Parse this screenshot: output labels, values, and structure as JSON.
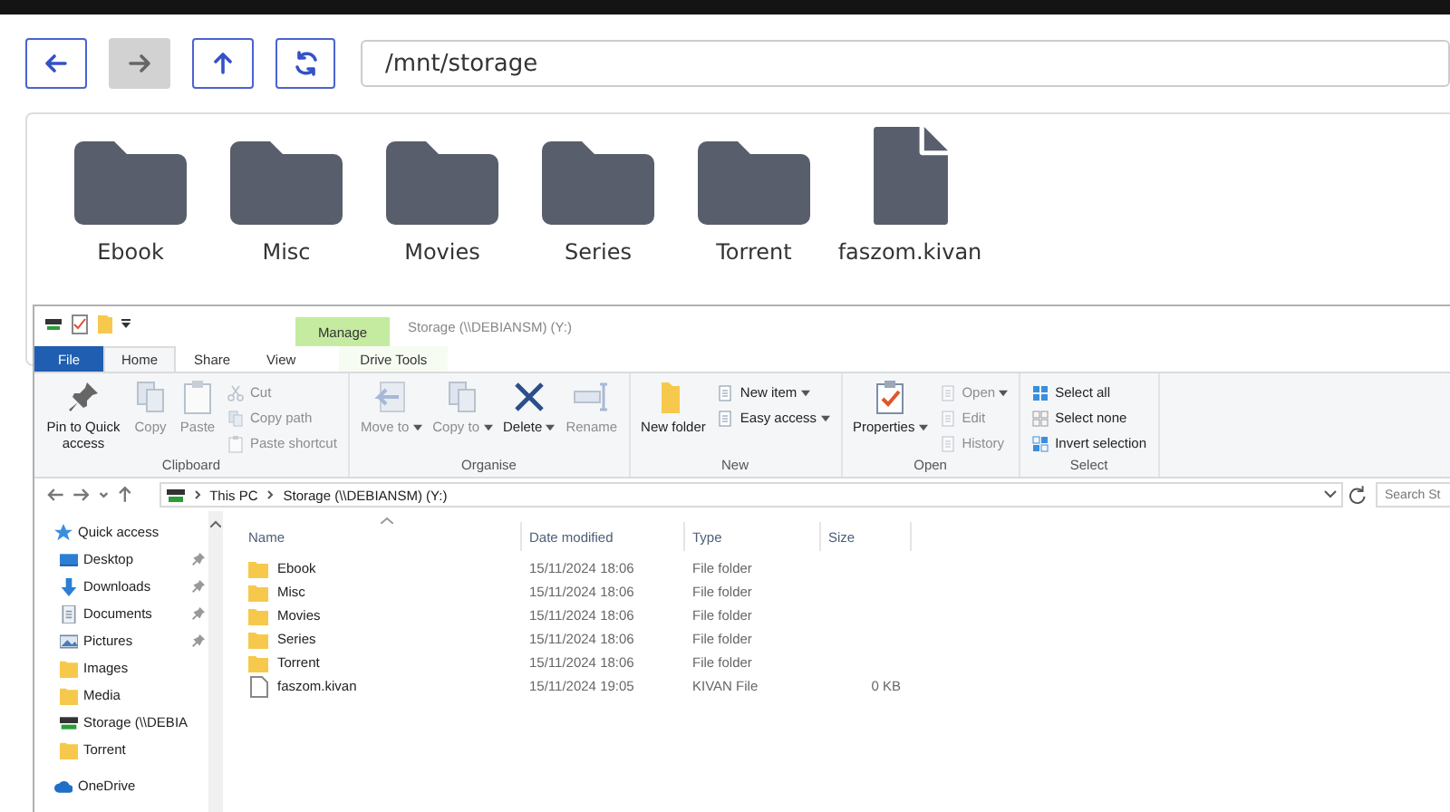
{
  "browser": {
    "nav_buttons": [
      {
        "kind": "back",
        "disabled": false
      },
      {
        "kind": "forward",
        "disabled": true
      },
      {
        "kind": "up",
        "disabled": false
      },
      {
        "kind": "refresh",
        "disabled": false
      }
    ],
    "path": "/mnt/storage",
    "items": [
      {
        "name": "Ebook",
        "kind": "folder"
      },
      {
        "name": "Misc",
        "kind": "folder"
      },
      {
        "name": "Movies",
        "kind": "folder"
      },
      {
        "name": "Series",
        "kind": "folder"
      },
      {
        "name": "Torrent",
        "kind": "folder"
      },
      {
        "name": "faszom.kivan",
        "kind": "file"
      }
    ]
  },
  "explorer": {
    "context_tab": "Manage",
    "title": "Storage (\\\\DEBIANSM) (Y:)",
    "tabs": [
      {
        "label": "File",
        "kind": "file",
        "selected": false
      },
      {
        "label": "Home",
        "kind": "tab",
        "selected": true
      },
      {
        "label": "Share",
        "kind": "tab",
        "selected": false
      },
      {
        "label": "View",
        "kind": "tab",
        "selected": false
      },
      {
        "label": "Drive Tools",
        "kind": "context",
        "selected": false
      }
    ],
    "ribbon": [
      {
        "label": "Clipboard",
        "buttons": [
          {
            "label": "Pin to Quick access",
            "kind": "large",
            "disabled": false,
            "dropdown": false
          },
          {
            "label": "Copy",
            "kind": "large",
            "disabled": true,
            "dropdown": false
          },
          {
            "label": "Paste",
            "kind": "large",
            "disabled": true,
            "dropdown": false
          },
          {
            "label": "Cut",
            "kind": "small",
            "disabled": true,
            "dropdown": false
          },
          {
            "label": "Copy path",
            "kind": "small",
            "disabled": true,
            "dropdown": false
          },
          {
            "label": "Paste shortcut",
            "kind": "small",
            "disabled": true,
            "dropdown": false
          }
        ]
      },
      {
        "label": "Organise",
        "buttons": [
          {
            "label": "Move to",
            "kind": "large",
            "disabled": true,
            "dropdown": true
          },
          {
            "label": "Copy to",
            "kind": "large",
            "disabled": true,
            "dropdown": true
          },
          {
            "label": "Delete",
            "kind": "large",
            "disabled": false,
            "dropdown": true
          },
          {
            "label": "Rename",
            "kind": "large",
            "disabled": true,
            "dropdown": false
          }
        ]
      },
      {
        "label": "New",
        "buttons": [
          {
            "label": "New folder",
            "kind": "large",
            "disabled": false,
            "dropdown": false
          },
          {
            "label": "New item",
            "kind": "small",
            "disabled": false,
            "dropdown": true
          },
          {
            "label": "Easy access",
            "kind": "small",
            "disabled": false,
            "dropdown": true
          }
        ]
      },
      {
        "label": "Open",
        "buttons": [
          {
            "label": "Properties",
            "kind": "large",
            "disabled": false,
            "dropdown": true
          },
          {
            "label": "Open",
            "kind": "small",
            "disabled": true,
            "dropdown": true
          },
          {
            "label": "Edit",
            "kind": "small",
            "disabled": true,
            "dropdown": false
          },
          {
            "label": "History",
            "kind": "small",
            "disabled": true,
            "dropdown": false
          }
        ]
      },
      {
        "label": "Select",
        "buttons": [
          {
            "label": "Select all",
            "kind": "small",
            "disabled": false,
            "dropdown": false
          },
          {
            "label": "Select none",
            "kind": "small",
            "disabled": false,
            "dropdown": false
          },
          {
            "label": "Invert selection",
            "kind": "small",
            "disabled": false,
            "dropdown": false
          }
        ]
      }
    ],
    "breadcrumbs": [
      "This PC",
      "Storage (\\\\DEBIANSM) (Y:)"
    ],
    "search": {
      "placeholder": "Search St"
    },
    "sidebar": [
      {
        "label": "Quick access",
        "kind": "header",
        "pinned": false
      },
      {
        "label": "Desktop",
        "kind": "item",
        "pinned": true
      },
      {
        "label": "Downloads",
        "kind": "item",
        "pinned": true
      },
      {
        "label": "Documents",
        "kind": "item",
        "pinned": true
      },
      {
        "label": "Pictures",
        "kind": "item",
        "pinned": true
      },
      {
        "label": "Images",
        "kind": "item",
        "pinned": false
      },
      {
        "label": "Media",
        "kind": "item",
        "pinned": false
      },
      {
        "label": "Storage (\\\\DEBIA",
        "kind": "item",
        "pinned": false
      },
      {
        "label": "Torrent",
        "kind": "item",
        "pinned": false
      },
      {
        "label": "OneDrive",
        "kind": "header",
        "pinned": false
      }
    ],
    "columns": [
      "Name",
      "Date modified",
      "Type",
      "Size"
    ],
    "rows": [
      {
        "name": "Ebook",
        "kind": "folder",
        "date": "15/11/2024 18:06",
        "type": "File folder"
      },
      {
        "name": "Misc",
        "kind": "folder",
        "date": "15/11/2024 18:06",
        "type": "File folder"
      },
      {
        "name": "Movies",
        "kind": "folder",
        "date": "15/11/2024 18:06",
        "type": "File folder"
      },
      {
        "name": "Series",
        "kind": "folder",
        "date": "15/11/2024 18:06",
        "type": "File folder"
      },
      {
        "name": "Torrent",
        "kind": "folder",
        "date": "15/11/2024 18:06",
        "type": "File folder"
      },
      {
        "name": "faszom.kivan",
        "kind": "file",
        "date": "15/11/2024 19:05",
        "type": "KIVAN File",
        "size": "0 KB"
      }
    ]
  }
}
